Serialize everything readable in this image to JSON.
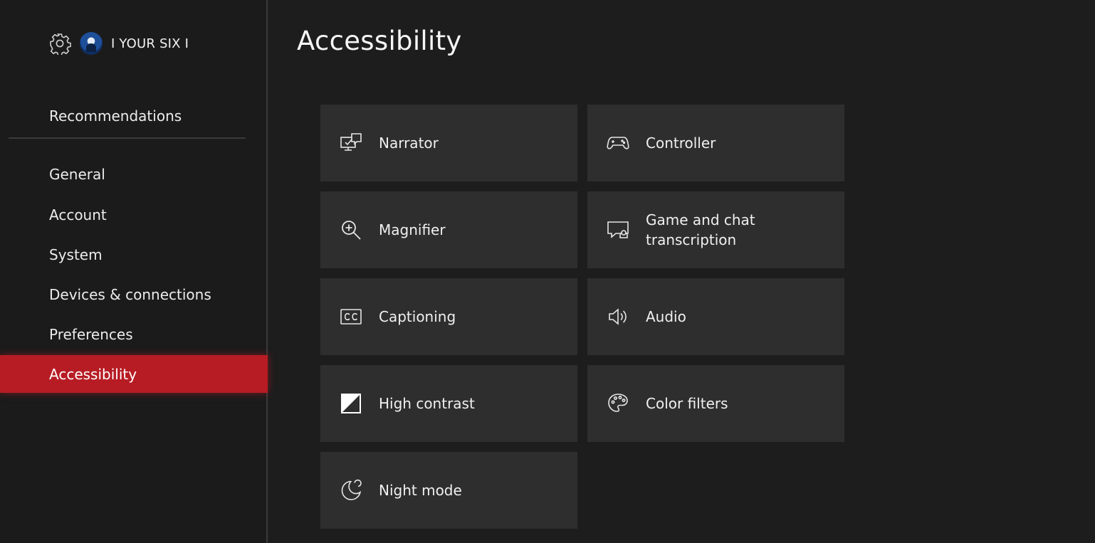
{
  "profile": {
    "gamertag": "I YOUR SIX I"
  },
  "sidebar": {
    "items": [
      {
        "label": "Recommendations"
      },
      {
        "label": "General"
      },
      {
        "label": "Account"
      },
      {
        "label": "System"
      },
      {
        "label": "Devices & connections"
      },
      {
        "label": "Preferences"
      },
      {
        "label": "Accessibility",
        "selected": true
      }
    ]
  },
  "main": {
    "title": "Accessibility",
    "tiles": [
      {
        "label": "Narrator",
        "icon": "narrator-icon"
      },
      {
        "label": "Controller",
        "icon": "controller-icon"
      },
      {
        "label": "Magnifier",
        "icon": "magnifier-icon"
      },
      {
        "label": "Game and chat transcription",
        "icon": "chat-transcription-icon"
      },
      {
        "label": "Captioning",
        "icon": "closed-captions-icon"
      },
      {
        "label": "Audio",
        "icon": "speaker-icon"
      },
      {
        "label": "High contrast",
        "icon": "high-contrast-icon"
      },
      {
        "label": "Color filters",
        "icon": "palette-icon"
      },
      {
        "label": "Night mode",
        "icon": "moon-icon"
      }
    ]
  },
  "colors": {
    "background": "#1d1d1d",
    "sidebar": "#1b1b1b",
    "tile": "#2e2e2e",
    "accent": "#b71c24",
    "text": "#f0f0f0"
  }
}
